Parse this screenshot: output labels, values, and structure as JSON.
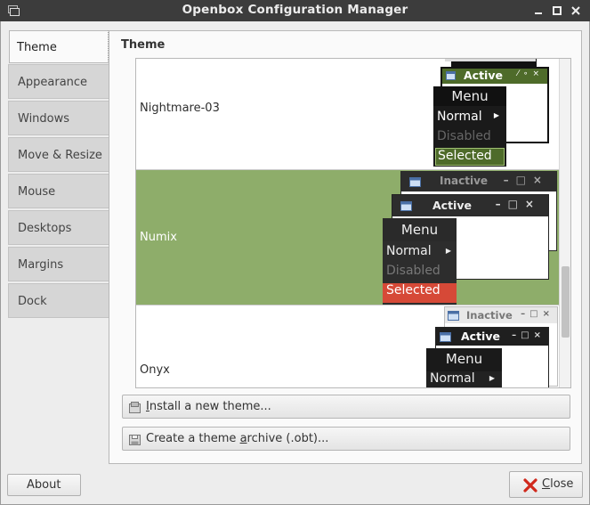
{
  "window": {
    "title": "Openbox Configuration Manager",
    "app_icon": "window-icon",
    "buttons": [
      "minimize-icon",
      "maximize-icon",
      "close-icon"
    ]
  },
  "sidebar": {
    "items": [
      {
        "label": "Theme",
        "active": true
      },
      {
        "label": "Appearance"
      },
      {
        "label": "Windows"
      },
      {
        "label": "Move & Resize"
      },
      {
        "label": "Mouse"
      },
      {
        "label": "Desktops"
      },
      {
        "label": "Margins"
      },
      {
        "label": "Dock"
      }
    ]
  },
  "main": {
    "section_title": "Theme",
    "themes": [
      {
        "name": "Nightmare-03",
        "selected": false,
        "preview": {
          "active": "Active",
          "menu": "Menu",
          "items": [
            "Normal",
            "Disabled",
            "Selected"
          ],
          "accent": "#4e6b2a"
        }
      },
      {
        "name": "Numix",
        "selected": true,
        "preview": {
          "inactive": "Inactive",
          "active": "Active",
          "menu": "Menu",
          "items": [
            "Normal",
            "Disabled",
            "Selected"
          ],
          "accent": "#d64937"
        }
      },
      {
        "name": "Onyx",
        "selected": false,
        "preview": {
          "inactive": "Inactive",
          "active": "Active",
          "menu": "Menu",
          "items": [
            "Normal"
          ]
        }
      }
    ],
    "selection_color": "#8ead6a",
    "install_button": {
      "pre": "",
      "mnemonic": "I",
      "post": "nstall a new theme..."
    },
    "archive_button": {
      "pre": "Create a theme ",
      "mnemonic": "a",
      "post": "rchive (.obt)..."
    }
  },
  "footer": {
    "about": {
      "pre": "About",
      "label": "About"
    },
    "close": {
      "mnemonic": "C",
      "post": "lose"
    }
  }
}
